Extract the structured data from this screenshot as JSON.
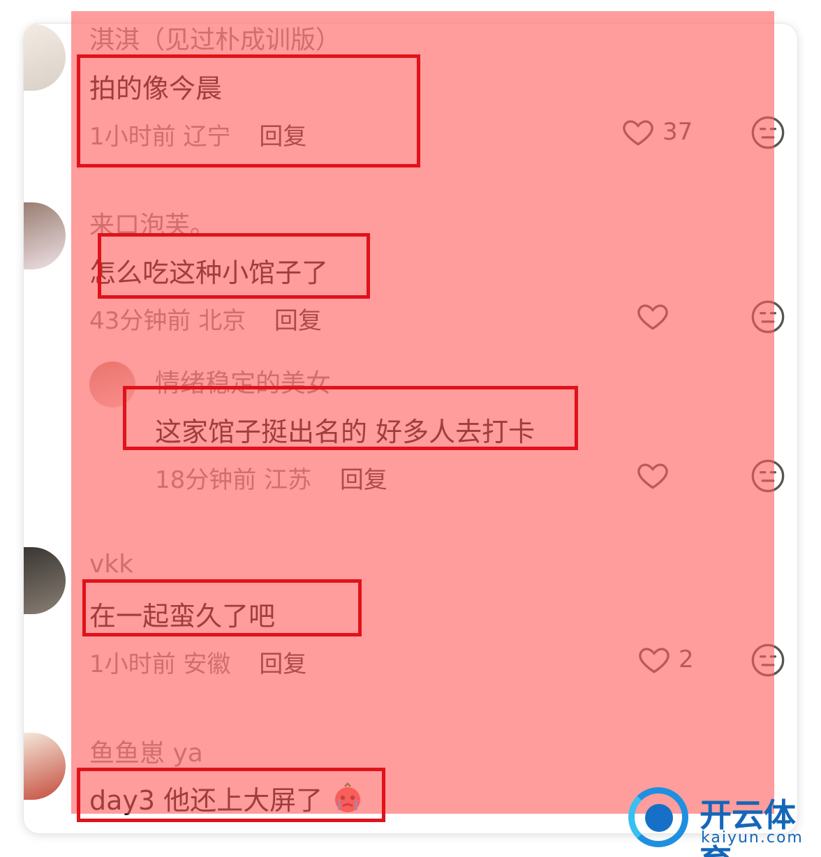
{
  "comments": [
    {
      "username": "淇淇（见过朴成训版）",
      "text": "拍的像今晨",
      "time": "1小时前",
      "location": "辽宁",
      "reply_label": "回复",
      "likes": "37"
    },
    {
      "username": "来口泡芙。",
      "text": "怎么吃这种小馆子了",
      "time": "43分钟前",
      "location": "北京",
      "reply_label": "回复",
      "likes": ""
    },
    {
      "username": "情绪稳定的美女",
      "text": "这家馆子挺出名的 好多人去打卡",
      "time": "18分钟前",
      "location": "江苏",
      "reply_label": "回复",
      "likes": ""
    },
    {
      "username": "vkk",
      "text": "在一起蛮久了吧",
      "time": "1小时前",
      "location": "安徽",
      "reply_label": "回复",
      "likes": "2"
    },
    {
      "username": "鱼鱼崽 ya",
      "text": "day3 他还上大屏了",
      "emoji": "crying-face",
      "time": "",
      "location": "",
      "reply_label": "",
      "likes": ""
    }
  ],
  "icons": {
    "like": "heart-outline-icon",
    "reaction": "meh-face-icon"
  },
  "colors": {
    "overlay": "#ff5a5a",
    "highlight_box": "#e0121b",
    "watermark": "#1467b8"
  },
  "watermark": {
    "text": "开云体育",
    "domain": "kaiyun.com"
  }
}
